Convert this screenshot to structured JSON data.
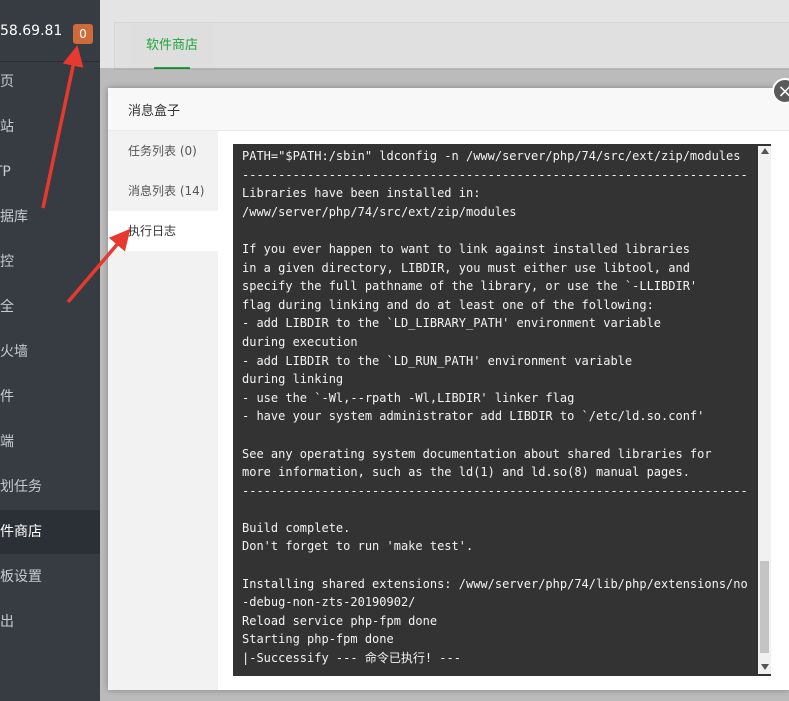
{
  "sidebar": {
    "ip": "58.69.81",
    "badge": "0",
    "items": [
      {
        "label": "首页"
      },
      {
        "label": "网站"
      },
      {
        "label": "FTP"
      },
      {
        "label": "数据库"
      },
      {
        "label": "监控"
      },
      {
        "label": "安全"
      },
      {
        "label": "防火墙"
      },
      {
        "label": "文件"
      },
      {
        "label": "终端"
      },
      {
        "label": "计划任务"
      },
      {
        "label": "软件商店"
      },
      {
        "label": "面板设置"
      },
      {
        "label": "退出"
      }
    ]
  },
  "topbar": {
    "tab_label": "软件商店"
  },
  "modal": {
    "title": "消息盒子",
    "close_icon": "×",
    "tabs": [
      {
        "label": "任务列表 (0)"
      },
      {
        "label": "消息列表 (14)"
      },
      {
        "label": "执行日志"
      }
    ],
    "log_text": "PATH=\"$PATH:/sbin\" ldconfig -n /www/server/php/74/src/ext/zip/modules\n----------------------------------------------------------------------\nLibraries have been installed in:\n/www/server/php/74/src/ext/zip/modules\n\nIf you ever happen to want to link against installed libraries\nin a given directory, LIBDIR, you must either use libtool, and\nspecify the full pathname of the library, or use the `-LLIBDIR'\nflag during linking and do at least one of the following:\n- add LIBDIR to the `LD_LIBRARY_PATH' environment variable\nduring execution\n- add LIBDIR to the `LD_RUN_PATH' environment variable\nduring linking\n- use the `-Wl,--rpath -Wl,LIBDIR' linker flag\n- have your system administrator add LIBDIR to `/etc/ld.so.conf'\n\nSee any operating system documentation about shared libraries for\nmore information, such as the ld(1) and ld.so(8) manual pages.\n----------------------------------------------------------------------\n\nBuild complete.\nDon't forget to run 'make test'.\n\nInstalling shared extensions: /www/server/php/74/lib/php/extensions/no\n-debug-non-zts-20190902/\nReload service php-fpm done\nStarting php-fpm done\n|-Successify --- 命令已执行! ---"
  },
  "colors": {
    "accent_green": "#20a53a",
    "badge_orange": "#cf6a3a",
    "annotation_red": "#e8392f"
  }
}
